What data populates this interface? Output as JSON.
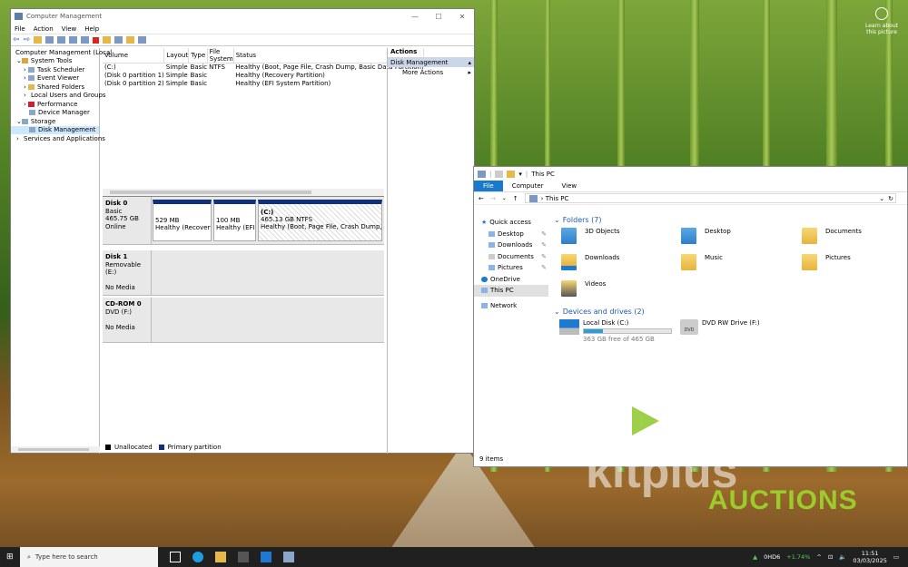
{
  "desktop": {
    "learn_text": "Learn about this picture"
  },
  "cm": {
    "title": "Computer Management",
    "menu": [
      "File",
      "Action",
      "View",
      "Help"
    ],
    "tree": [
      {
        "label": "Computer Management (Local"
      },
      {
        "label": "System Tools"
      },
      {
        "label": "Task Scheduler"
      },
      {
        "label": "Event Viewer"
      },
      {
        "label": "Shared Folders"
      },
      {
        "label": "Local Users and Groups"
      },
      {
        "label": "Performance"
      },
      {
        "label": "Device Manager"
      },
      {
        "label": "Storage"
      },
      {
        "label": "Disk Management"
      },
      {
        "label": "Services and Applications"
      }
    ],
    "columns": [
      "Volume",
      "Layout",
      "Type",
      "File System",
      "Status"
    ],
    "volumes": [
      [
        "(C:)",
        "Simple",
        "Basic",
        "NTFS",
        "Healthy (Boot, Page File, Crash Dump, Basic Data Partition)"
      ],
      [
        "(Disk 0 partition 1)",
        "Simple",
        "Basic",
        "",
        "Healthy (Recovery Partition)"
      ],
      [
        "(Disk 0 partition 2)",
        "Simple",
        "Basic",
        "",
        "Healthy (EFI System Partition)"
      ]
    ],
    "disk0": {
      "name": "Disk 0",
      "type": "Basic",
      "size": "465.75 GB",
      "state": "Online",
      "p1": {
        "size": "529 MB",
        "status": "Healthy (Recovery Pa"
      },
      "p2": {
        "size": "100 MB",
        "status": "Healthy (EFI Sy"
      },
      "p3": {
        "name": "(C:)",
        "size": "465.13 GB NTFS",
        "status": "Healthy (Boot, Page File, Crash Dump, Basic Dat"
      }
    },
    "disk1": {
      "name": "Disk 1",
      "type": "Removable (E:)",
      "state": "No Media"
    },
    "cdrom": {
      "name": "CD-ROM 0",
      "type": "DVD (F:)",
      "state": "No Media"
    },
    "legend": {
      "unallocated": "Unallocated",
      "primary": "Primary partition"
    },
    "actions": {
      "header": "Actions",
      "selected": "Disk Management",
      "more": "More Actions"
    }
  },
  "ex": {
    "title": "This PC",
    "ribbon": [
      "File",
      "Computer",
      "View"
    ],
    "address": "This PC",
    "nav": [
      "Quick access",
      "Desktop",
      "Downloads",
      "Documents",
      "Pictures",
      "OneDrive",
      "This PC",
      "Network"
    ],
    "folders_header": "Folders (7)",
    "folders": [
      "3D Objects",
      "Desktop",
      "Documents",
      "Downloads",
      "Music",
      "Pictures",
      "Videos"
    ],
    "devices_header": "Devices and drives (2)",
    "drive_c": {
      "name": "Local Disk (C:)",
      "free": "363 GB free of 465 GB"
    },
    "drive_f": {
      "name": "DVD RW Drive (F:)"
    },
    "status": "9 items"
  },
  "taskbar": {
    "search_placeholder": "Type here to search",
    "ticker": "0HD6",
    "ticker_change": "+1.74%",
    "time": "11:51",
    "date": "03/03/2025"
  },
  "watermark": {
    "brand": "kitplus",
    "sub": "AUCTIONS"
  }
}
